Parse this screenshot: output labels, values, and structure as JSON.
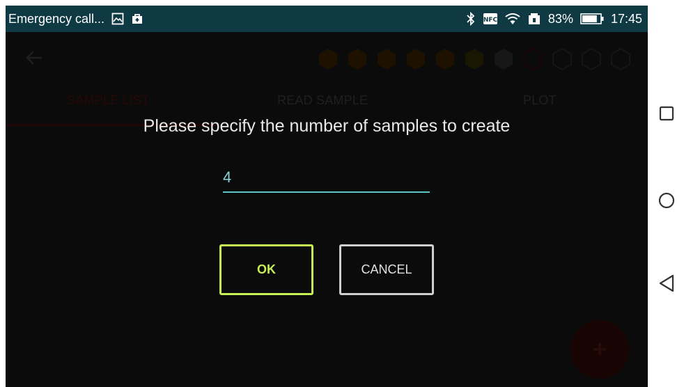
{
  "status_bar": {
    "notification_text": "Emergency call...",
    "icons_left": [
      "image-icon",
      "bag-icon"
    ],
    "icons_right": [
      "bluetooth-icon",
      "nfc-icon",
      "wifi-icon",
      "vibrate-icon"
    ],
    "battery_percent": "83%",
    "battery_level": 0.83,
    "time": "17:45",
    "background_color": "#0f3a44"
  },
  "app_background": {
    "back_icon": "back-arrow-icon",
    "hexagons": [
      {
        "state": "filled",
        "color": "#3a2000"
      },
      {
        "state": "filled",
        "color": "#3a2000"
      },
      {
        "state": "filled",
        "color": "#3a2000"
      },
      {
        "state": "filled",
        "color": "#3a2000"
      },
      {
        "state": "filled",
        "color": "#3a2000"
      },
      {
        "state": "filled",
        "color": "#2f2a05"
      },
      {
        "state": "filled",
        "color": "#2a2a2a"
      },
      {
        "state": "outline",
        "color": "#3a0a0a"
      },
      {
        "state": "outline",
        "color": "#2a2a2a"
      },
      {
        "state": "outline",
        "color": "#2a2a2a"
      },
      {
        "state": "outline",
        "color": "#2a2a2a"
      }
    ],
    "tabs": [
      {
        "label": "SAMPLE LIST",
        "active": true,
        "color": "#4a0f0f"
      },
      {
        "label": "READ SAMPLE",
        "active": false,
        "color": "#3a3a3a"
      },
      {
        "label": "PLOT",
        "active": false,
        "color": "#3a3a3a"
      }
    ],
    "fab_label": "+"
  },
  "dialog": {
    "title": "Please specify the number of samples to create",
    "input_value": "4",
    "ok_label": "OK",
    "cancel_label": "CANCEL",
    "ok_color": "#c6ef53",
    "accent_color": "#5bc4c6"
  },
  "nav_bar": {
    "buttons": [
      "recents-square-icon",
      "home-circle-icon",
      "back-triangle-icon"
    ]
  }
}
